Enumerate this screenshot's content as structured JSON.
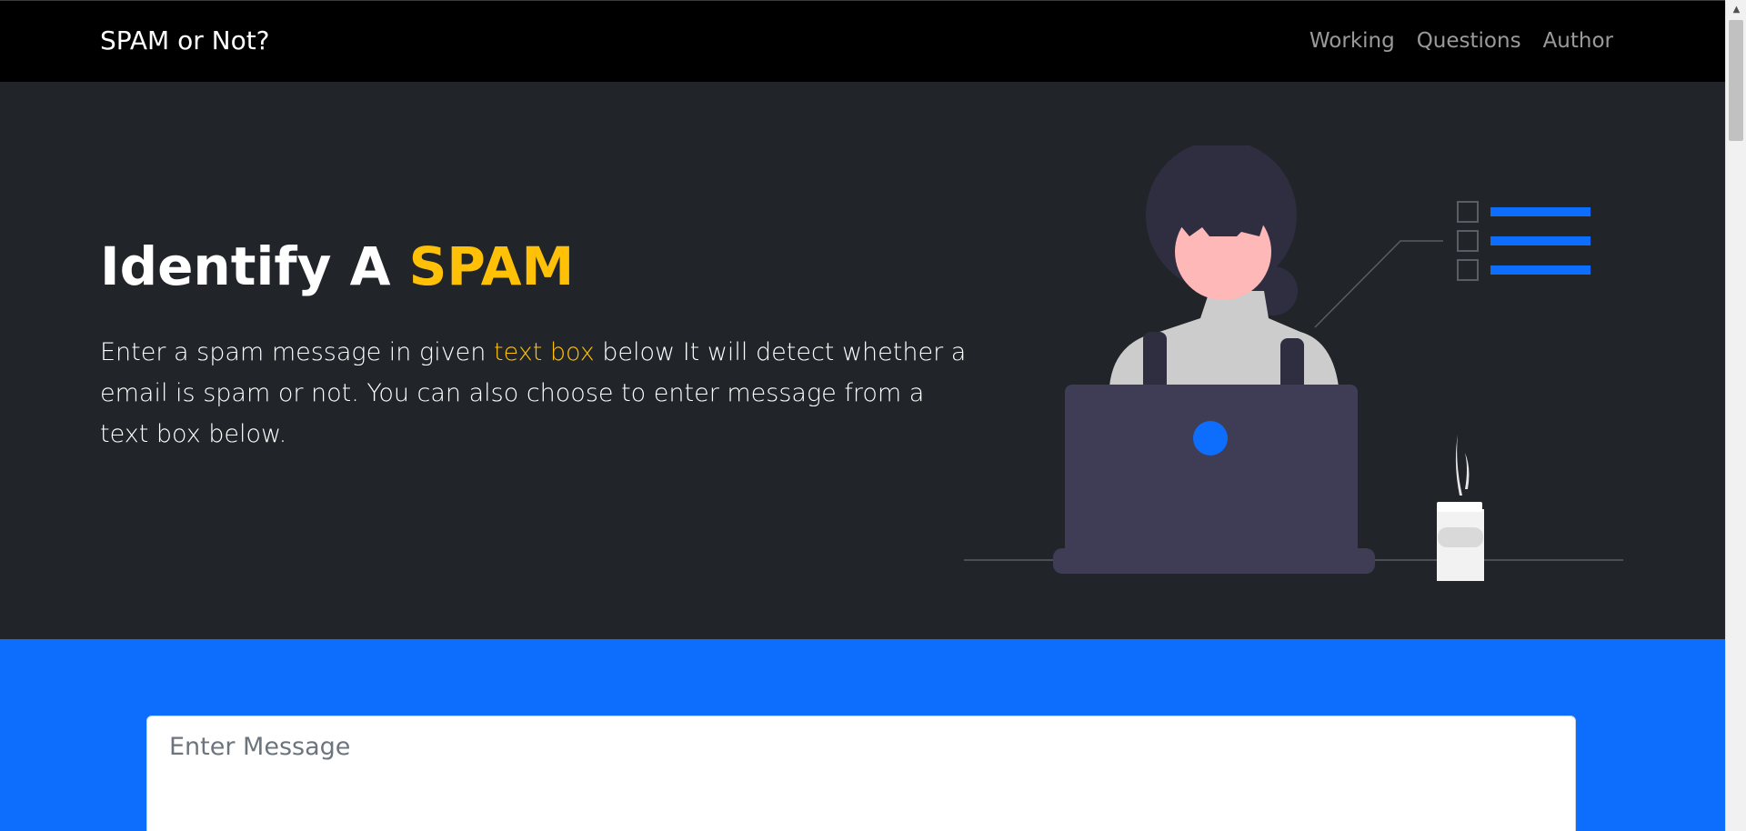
{
  "navbar": {
    "brand": "SPAM or Not?",
    "links": [
      "Working",
      "Questions",
      "Author"
    ]
  },
  "hero": {
    "title_prefix": "Identify A ",
    "title_accent": "SPAM",
    "text_before": "Enter a spam message in given ",
    "text_accent": "text box",
    "text_after": " below It will detect whether a email is spam or not. You can also choose to enter message from a text box below."
  },
  "form": {
    "message_placeholder": "Enter Message"
  },
  "colors": {
    "accent": "#ffc107",
    "primary": "#0d6efd",
    "hero_bg": "#212529",
    "navbar_bg": "#000000"
  },
  "icons": {
    "illustration": "woman-at-laptop-illustration",
    "scroll_up": "triangle-up"
  }
}
